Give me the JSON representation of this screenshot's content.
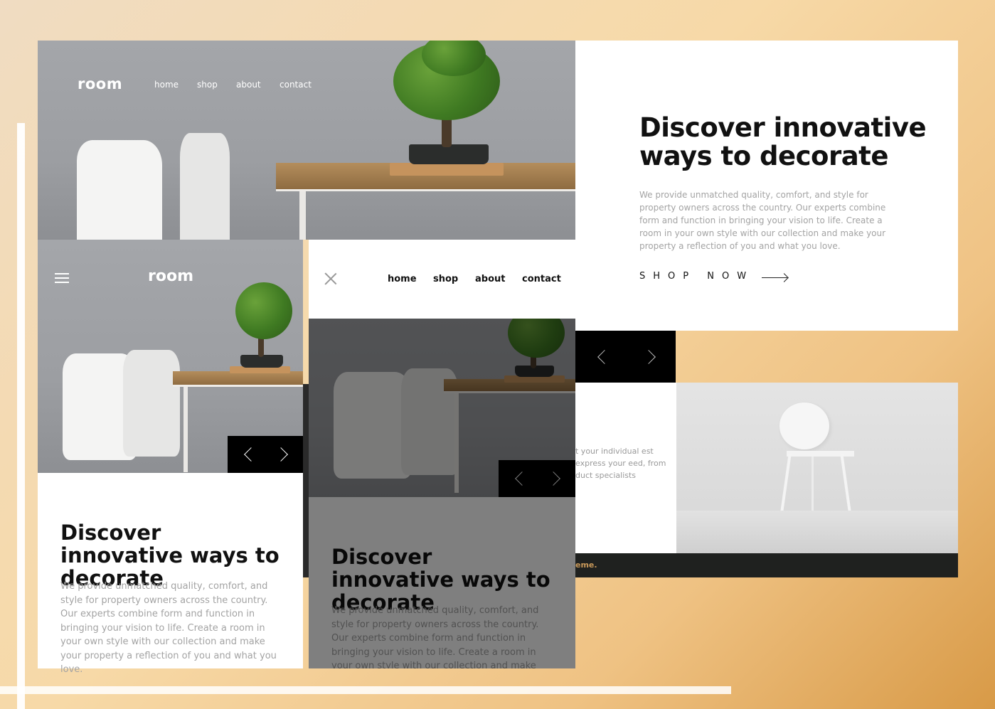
{
  "desktop": {
    "logo": "room",
    "nav": [
      "home",
      "shop",
      "about",
      "contact"
    ],
    "hero_title": "Discover innovative ways to decorate",
    "hero_description": "We provide unmatched quality, comfort, and style for property owners across the country. Our experts combine form and function in bringing your vision to life. Create a room in your own style with our collection and make your property a reflection of you and what you love.",
    "cta_label": "SHOP NOW",
    "about_fragment": "t your individual est express your eed, from duct specialists",
    "footer_fragment": "eme."
  },
  "mobile": {
    "logo": "room",
    "hero_title": "Discover innovative ways to decorate",
    "hero_description": "We provide unmatched quality, comfort, and style for property owners across the country. Our experts combine form and function in bringing your vision to life. Create a room in your own style with our collection and make your property a reflection of you and what you love."
  },
  "mobile_menu": {
    "nav": [
      "home",
      "shop",
      "about",
      "contact"
    ],
    "hero_title": "Discover innovative ways to decorate",
    "hero_description": "We provide unmatched quality, comfort, and style for property owners across the country. Our experts combine form and function in bringing your vision to life. Create a room in your own style with our collection and make your property a reflection of you and what you love."
  },
  "icons": {
    "menu": "hamburger-icon",
    "close": "close-icon",
    "prev": "chevron-left-icon",
    "next": "chevron-right-icon",
    "cta_arrow": "arrow-right-icon"
  },
  "colors": {
    "accent": "#c8995a",
    "dark": "#000000",
    "footer": "#1f211f"
  }
}
